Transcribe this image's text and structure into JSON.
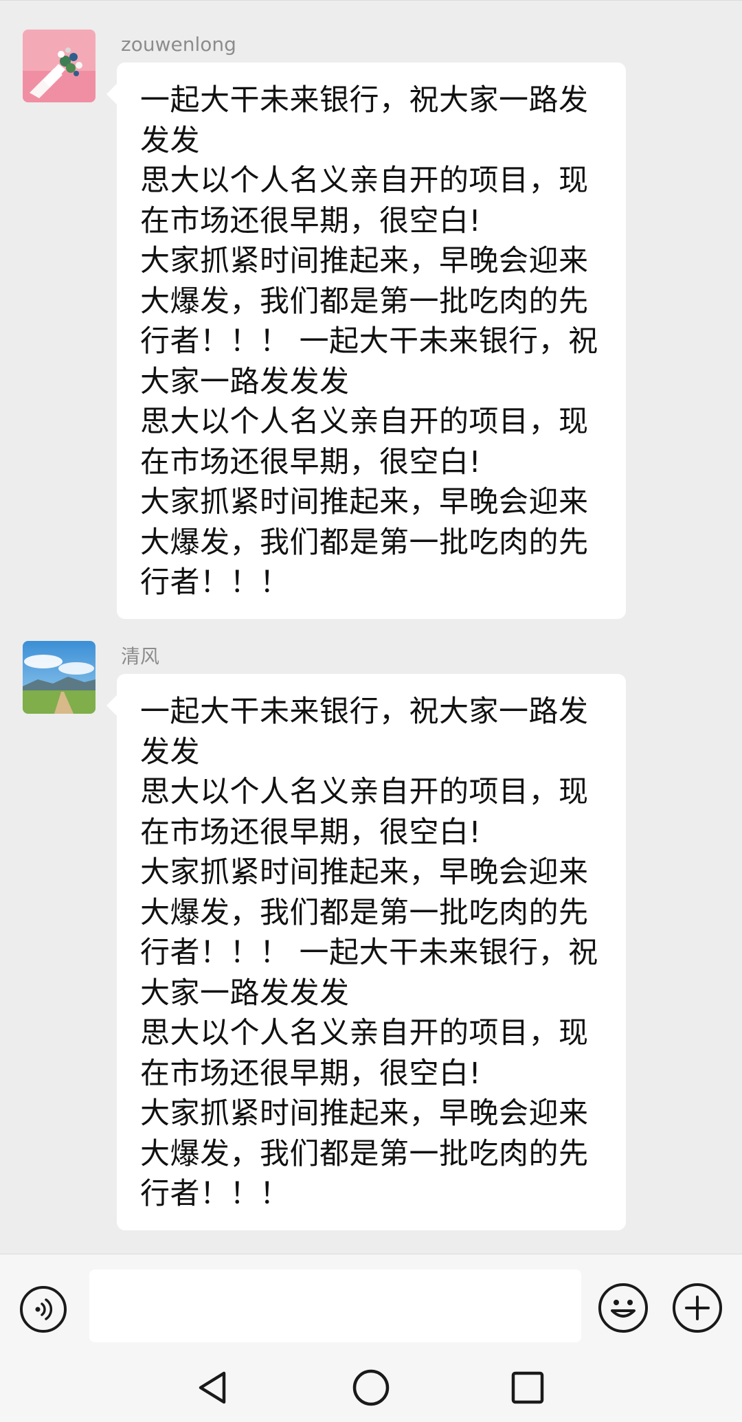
{
  "messages": [
    {
      "sender": "zouwenlong",
      "avatar_icon": "flower-bouquet-avatar",
      "text": "一起大干未来银行，祝大家一路发发发\n思大以个人名义亲自开的项目，现在市场还很早期，很空白!\n大家抓紧时间推起来，早晚会迎来大爆发，我们都是第一批吃肉的先行者！！！ 一起大干未来银行，祝大家一路发发发\n思大以个人名义亲自开的项目，现在市场还很早期，很空白!\n大家抓紧时间推起来，早晚会迎来大爆发，我们都是第一批吃肉的先行者！！！"
    },
    {
      "sender": "清风",
      "avatar_icon": "landscape-avatar",
      "text": "一起大干未来银行，祝大家一路发发发\n思大以个人名义亲自开的项目，现在市场还很早期，很空白!\n大家抓紧时间推起来，早晚会迎来大爆发，我们都是第一批吃肉的先行者！！！ 一起大干未来银行，祝大家一路发发发\n思大以个人名义亲自开的项目，现在市场还很早期，很空白!\n大家抓紧时间推起来，早晚会迎来大爆发，我们都是第一批吃肉的先行者！！！"
    }
  ],
  "input_bar": {
    "voice_icon": "voice-icon",
    "input_value": "",
    "emoji_icon": "emoji-icon",
    "plus_icon": "plus-icon"
  },
  "nav_bar": {
    "back_icon": "back-triangle-icon",
    "home_icon": "home-circle-icon",
    "recents_icon": "recents-square-icon"
  },
  "colors": {
    "chat_background": "#ededed",
    "bubble": "#ffffff",
    "sender_name": "#8c8c8c",
    "text": "#111111",
    "bars": "#f6f6f6"
  }
}
